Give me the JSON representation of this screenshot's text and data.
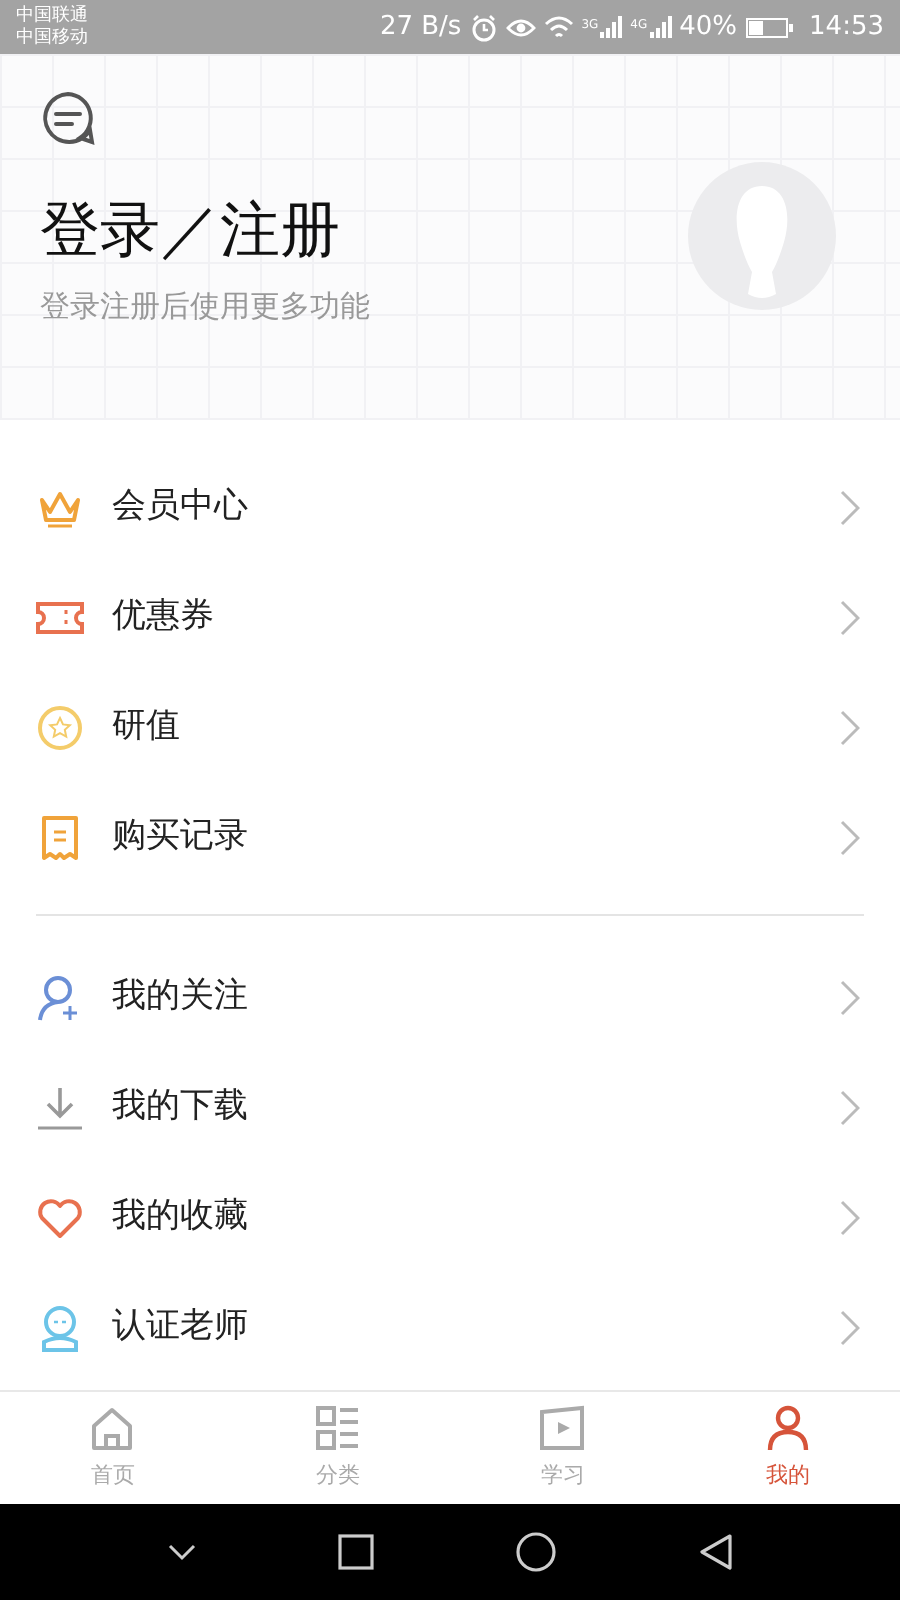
{
  "status_bar": {
    "carriers": [
      "中国联通",
      "中国移动"
    ],
    "speed": "27 B/s",
    "networks": [
      "3G",
      "4G"
    ],
    "battery_text": "40%",
    "time": "14:53"
  },
  "header": {
    "title": "登录／注册",
    "subtitle": "登录注册后使用更多功能"
  },
  "menu_groups": [
    [
      {
        "kind": "crown",
        "label": "会员中心"
      },
      {
        "kind": "ticket",
        "label": "优惠券"
      },
      {
        "kind": "coin",
        "label": "研值"
      },
      {
        "kind": "receipt",
        "label": "购买记录"
      }
    ],
    [
      {
        "kind": "follow",
        "label": "我的关注"
      },
      {
        "kind": "download",
        "label": "我的下载"
      },
      {
        "kind": "heart",
        "label": "我的收藏"
      },
      {
        "kind": "teacher",
        "label": "认证老师"
      }
    ]
  ],
  "tabs": [
    {
      "kind": "home",
      "label": "首页",
      "selected": false
    },
    {
      "kind": "category",
      "label": "分类",
      "selected": false
    },
    {
      "kind": "study",
      "label": "学习",
      "selected": false
    },
    {
      "kind": "me",
      "label": "我的",
      "selected": true
    }
  ]
}
